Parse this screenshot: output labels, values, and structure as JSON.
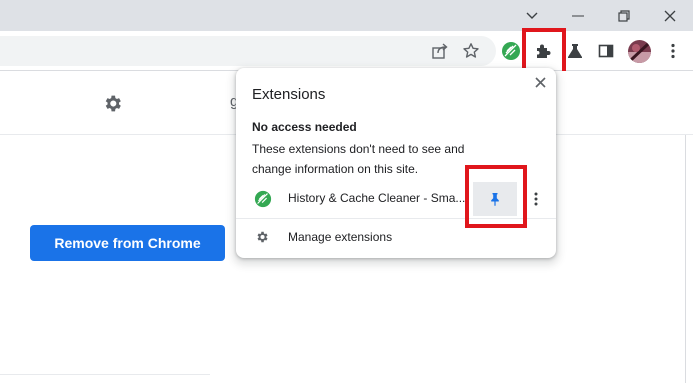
{
  "popup": {
    "title": "Extensions",
    "section_title": "No access needed",
    "section_description": "These extensions don't need to see and change information on this site.",
    "extension": {
      "name": "History & Cache Cleaner - Sma...",
      "icon": "leaf-extension-icon"
    },
    "manage_label": "Manage extensions"
  },
  "page": {
    "remove_button_label": "Remove from Chrome",
    "header_partial_text": "g"
  },
  "toolbar": {
    "icons": [
      "share-icon",
      "star-icon",
      "leaf-extension-icon",
      "puzzle-icon",
      "flask-icon",
      "side-panel-icon",
      "avatar",
      "more-vert-icon"
    ]
  },
  "colors": {
    "accent": "#1a73e8",
    "highlight": "#e0161c",
    "pin": "#1a73e8",
    "extension_green": "#34a853"
  }
}
